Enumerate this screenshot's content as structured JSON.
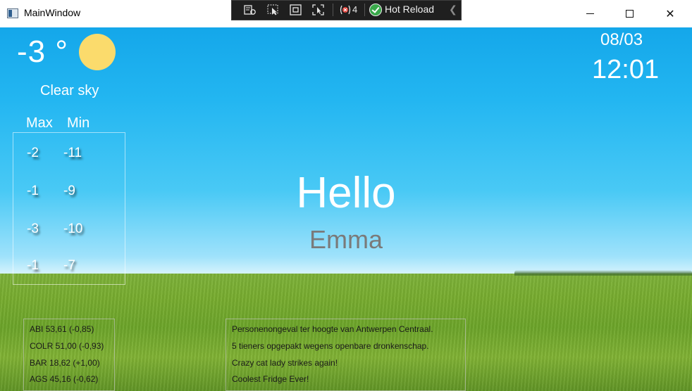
{
  "window": {
    "title": "MainWindow",
    "controls": {
      "minimize": "–",
      "maximize": "☐",
      "close": "✕"
    }
  },
  "devtoolbar": {
    "error_count": "4",
    "hot_reload_label": "Hot Reload",
    "icons": [
      "live-visual-tree-icon",
      "select-element-icon",
      "display-layout-adorners-icon",
      "track-focused-element-icon",
      "binding-failures-icon",
      "hot-reload-icon",
      "collapse-icon"
    ]
  },
  "weather": {
    "temperature": "-3 °",
    "condition": "Clear sky",
    "icon": "sun-icon",
    "icon_color": "#fbdb6c",
    "headers": {
      "max": "Max",
      "min": "Min"
    },
    "forecast": [
      {
        "max": "-2",
        "min": "-11"
      },
      {
        "max": "-1",
        "min": "-9"
      },
      {
        "max": "-3",
        "min": "-10"
      },
      {
        "max": "-1",
        "min": "-7"
      }
    ]
  },
  "clock": {
    "date": "08/03",
    "time": "12:01"
  },
  "greeting": {
    "hello": "Hello",
    "name": "Emma"
  },
  "stocks": [
    "ABI 53,61 (-0,85)",
    "COLR 51,00 (-0,93)",
    "BAR 18,62 (+1,00)",
    "AGS 45,16 (-0,62)"
  ],
  "news": [
    "Personenongeval ter hoogte van Antwerpen Centraal.",
    "5 tieners opgepakt wegens openbare dronkenschap.",
    "Crazy cat lady strikes again!",
    "Coolest Fridge Ever!"
  ]
}
